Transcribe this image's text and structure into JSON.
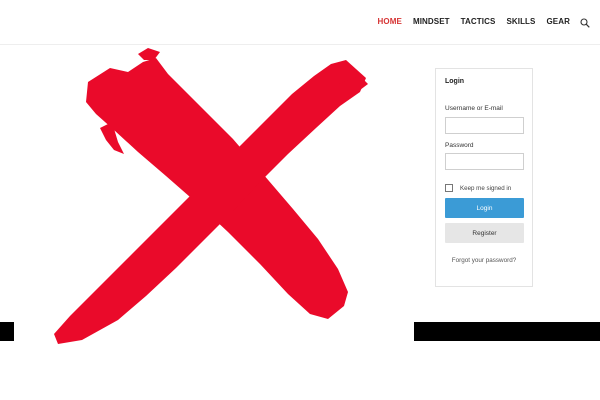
{
  "nav": {
    "items": [
      {
        "label": "HOME",
        "active": true
      },
      {
        "label": "MINDSET",
        "active": false
      },
      {
        "label": "TACTICS",
        "active": false
      },
      {
        "label": "SKILLS",
        "active": false
      },
      {
        "label": "GEAR",
        "active": false
      }
    ],
    "search_icon": "search-icon",
    "active_color": "#d63434"
  },
  "hero": {
    "icon": "red-x-mark-icon",
    "color": "#ea0a2a"
  },
  "login": {
    "title": "Login",
    "username_label": "Username or E-mail",
    "username_value": "",
    "password_label": "Password",
    "password_value": "",
    "remember_label": "Keep me signed in",
    "remember_checked": false,
    "login_button": "Login",
    "register_button": "Register",
    "forgot_link": "Forgot your password?",
    "login_button_color": "#3b9bd6"
  }
}
